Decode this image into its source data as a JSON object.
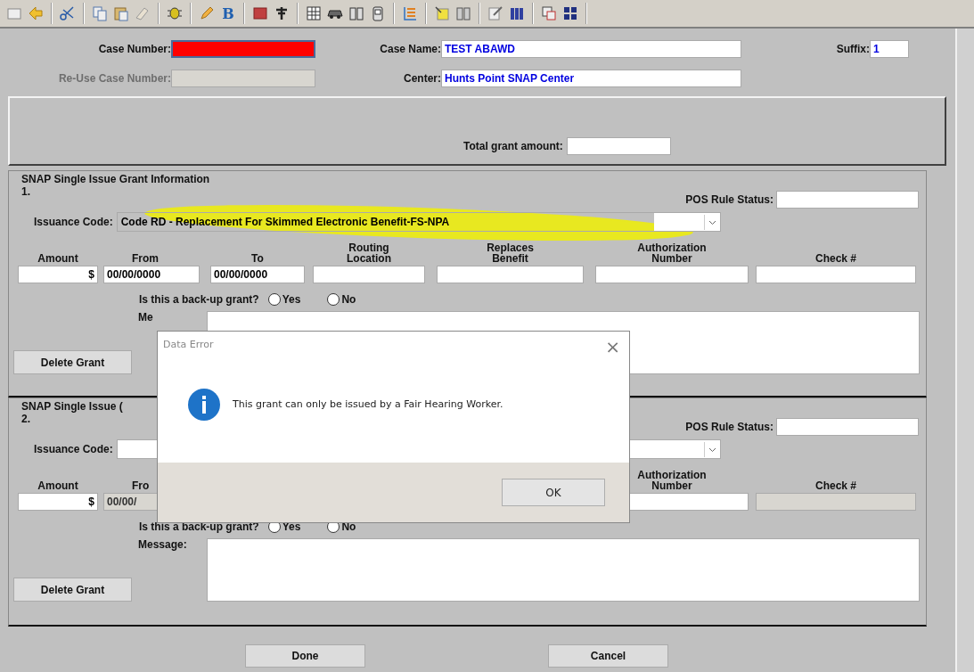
{
  "toolbar": {
    "bold_button": "B"
  },
  "case": {
    "case_number_label": "Case Number:",
    "case_number_redacted": true,
    "case_name_label": "Case Name:",
    "case_name": "TEST ABAWD",
    "suffix_label": "Suffix:",
    "suffix": "1",
    "reuse_label": "Re-Use Case Number:",
    "reuse_disabled": true,
    "center_label": "Center:",
    "center": "Hunts Point SNAP Center"
  },
  "total": {
    "label": "Total grant amount:"
  },
  "grants": [
    {
      "title": "SNAP Single Issue Grant Information",
      "number": "1.",
      "pos_label": "POS Rule Status:",
      "issuance_label": "Issuance Code:",
      "issuance_value": "Code RD - Replacement For Skimmed Electronic Benefit-FS-NPA",
      "highlighted": true,
      "columns": [
        {
          "kind": "field",
          "header": "Amount",
          "value": "$",
          "disabled": false
        },
        {
          "kind": "field",
          "header": "From",
          "value": "00/00/0000",
          "disabled": false
        },
        {
          "kind": "field",
          "header": "To",
          "value": "00/00/0000",
          "disabled": false
        },
        {
          "kind": "field",
          "header": "Routing Location",
          "disabled": false
        },
        {
          "kind": "field",
          "header": "Replaces Benefit",
          "disabled": false
        },
        {
          "kind": "field",
          "header": "Authorization Number",
          "disabled": false
        },
        {
          "kind": "field",
          "header": "Check #",
          "disabled": false
        }
      ],
      "backup_label": "Is this a back-up grant?",
      "options": [
        {
          "label": "Yes",
          "selected": false
        },
        {
          "label": "No",
          "selected": false
        }
      ],
      "message_label": "Me",
      "delete_button": "Delete Grant"
    },
    {
      "title": "SNAP Single Issue (",
      "number": "2.",
      "pos_label": "POS Rule Status:",
      "issuance_label": "Issuance Code:",
      "highlighted": false,
      "columns": [
        {
          "kind": "field",
          "header": "Amount",
          "value": "$",
          "disabled": false
        },
        {
          "kind": "field",
          "header": "Fro",
          "value": "00/00/",
          "disabled": true
        },
        {
          "kind": "covered"
        },
        {
          "kind": "covered"
        },
        {
          "kind": "covered"
        },
        {
          "kind": "field",
          "header": "Authorization Number",
          "disabled": false
        },
        {
          "kind": "field",
          "header": "Check #",
          "disabled": true
        }
      ],
      "backup_label": "Is this a back-up grant?",
      "options": [
        {
          "label": "Yes",
          "selected": false
        },
        {
          "label": "No",
          "selected": false
        }
      ],
      "message_label": "Message:",
      "delete_button": "Delete Grant"
    }
  ],
  "buttons": [
    {
      "label": "Done"
    },
    {
      "label": "Cancel"
    }
  ],
  "dialog": {
    "title": "Data Error",
    "close": "×",
    "message": "This grant can only be issued by a Fair Hearing Worker.",
    "button": "OK"
  }
}
